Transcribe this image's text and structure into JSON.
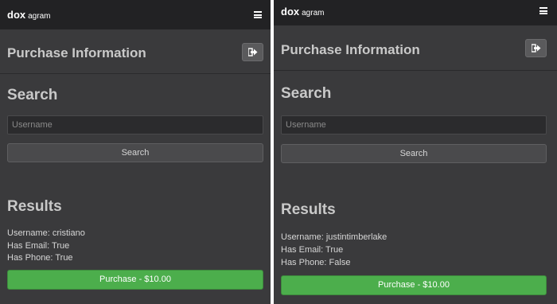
{
  "panels": [
    {
      "brand": {
        "main": "dox",
        "sub": "agram"
      },
      "header": {
        "title": "Purchase Information"
      },
      "search": {
        "title": "Search",
        "placeholder": "Username",
        "button_label": "Search"
      },
      "results": {
        "title": "Results",
        "username_line": "Username: cristiano",
        "email_line": "Has Email: True",
        "phone_line": "Has Phone: True"
      },
      "purchase_label": "Purchase - $10.00"
    },
    {
      "brand": {
        "main": "dox",
        "sub": "agram"
      },
      "header": {
        "title": "Purchase Information"
      },
      "search": {
        "title": "Search",
        "placeholder": "Username",
        "button_label": "Search"
      },
      "results": {
        "title": "Results",
        "username_line": "Username: justintimberlake",
        "email_line": "Has Email: True",
        "phone_line": "Has Phone: False"
      },
      "purchase_label": "Purchase - $10.00"
    }
  ],
  "icons": {
    "menu": "hamburger-menu-icon",
    "logout": "sign-out-icon"
  },
  "colors": {
    "navbar": "#222224",
    "background": "#3a3a3c",
    "purchase_button": "#4cae4c",
    "heading_text": "#c9c9c9"
  }
}
